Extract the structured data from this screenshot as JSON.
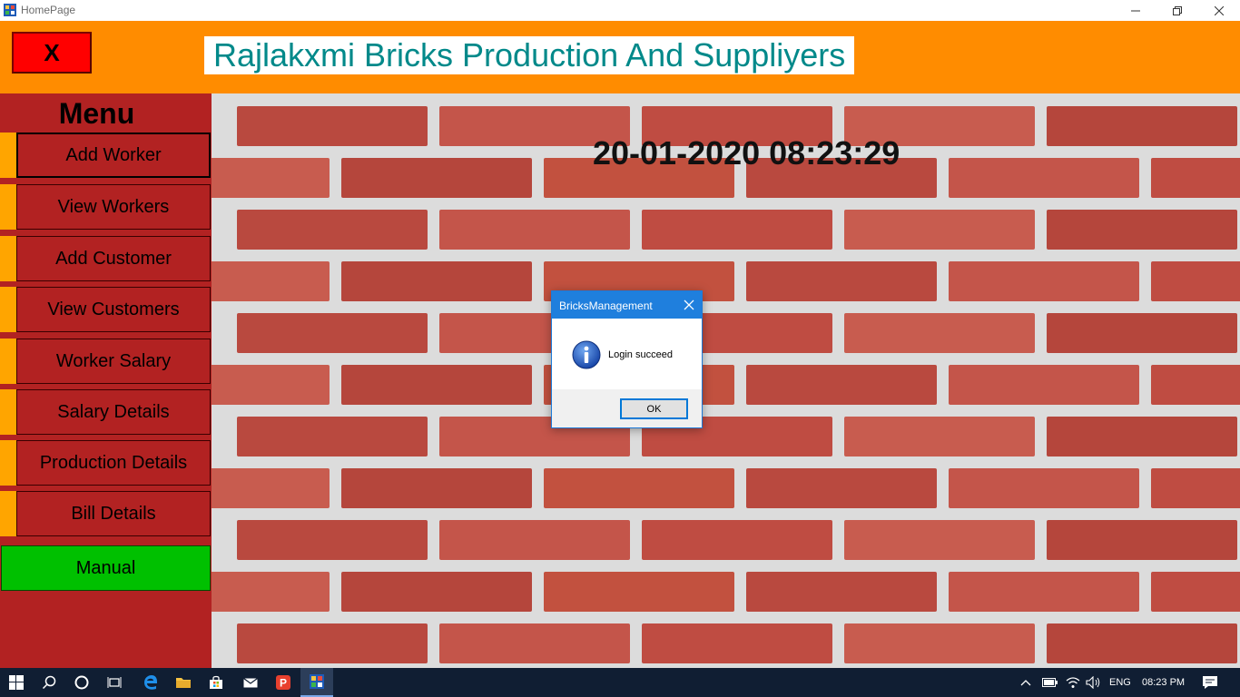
{
  "window": {
    "title": "HomePage"
  },
  "header": {
    "exit_label": "X",
    "app_title": "Rajlakxmi Bricks Production And Suppliyers"
  },
  "sidebar": {
    "title": "Menu",
    "items": [
      {
        "label": "Add Worker"
      },
      {
        "label": "View Workers"
      },
      {
        "label": "Add Customer"
      },
      {
        "label": "View Customers"
      },
      {
        "label": "Worker Salary"
      },
      {
        "label": "Salary Details"
      },
      {
        "label": "Production Details"
      },
      {
        "label": "Bill Details"
      }
    ],
    "manual_label": "Manual"
  },
  "main": {
    "datetime": "20-01-2020 08:23:29"
  },
  "dialog": {
    "title": "BricksManagement",
    "message": "Login succeed",
    "ok_label": "OK"
  },
  "taskbar": {
    "language": "ENG",
    "time": "08:23 PM"
  },
  "colors": {
    "header": "#ff8c00",
    "sidebar": "#b22222",
    "accent": "#ffa500",
    "title_text": "#00898a",
    "exit_button": "#ff0000",
    "manual_button": "#00c000"
  }
}
